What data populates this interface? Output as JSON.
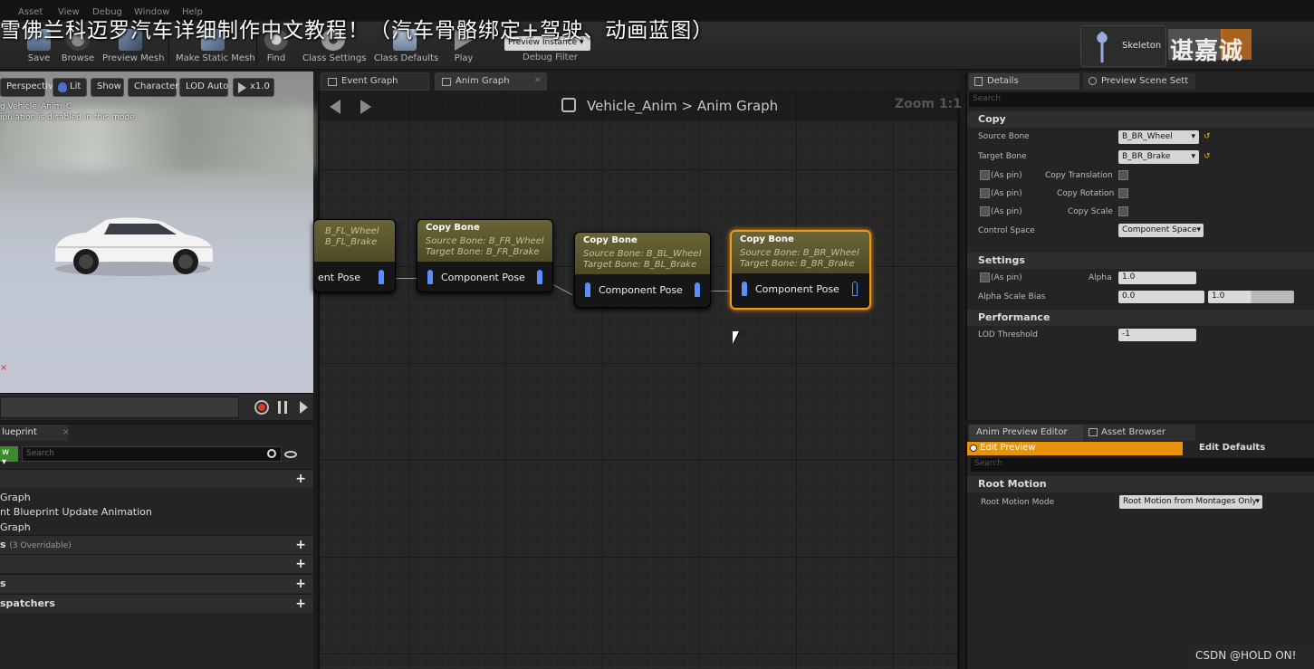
{
  "menubar": {
    "items": [
      "Asset",
      "View",
      "Debug",
      "Window",
      "Help"
    ]
  },
  "overlay_title": "雪佛兰科迈罗汽车详细制作中文教程！（汽车骨骼绑定+驾驶、动画蓝图）",
  "toolbar": {
    "buttons": [
      "Save",
      "Browse",
      "Preview Mesh",
      "Make Static Mesh",
      "Find",
      "Class Settings",
      "Class Defaults",
      "Play"
    ],
    "preview_instance": "Preview Instance",
    "debug_filter": "Debug Filter",
    "skeleton_label": "Skeleton",
    "watermark_text": "谌嘉诚"
  },
  "viewport": {
    "buttons": [
      "Perspective",
      "Lit",
      "Show",
      "Character",
      "LOD Auto",
      "x1.0"
    ],
    "info_line1": "g Vehicle_Anim_C",
    "info_line2": "ipulation is disabled in this mode."
  },
  "my_blueprint": {
    "tab": "lueprint",
    "add_label": "w",
    "search_placeholder": "Search",
    "rows": [
      {
        "label": "Graph",
        "header": false
      },
      {
        "label": "nt Blueprint Update Animation",
        "header": false
      },
      {
        "label": "Graph",
        "header": false
      },
      {
        "label": "s",
        "suffix": "(3 Overridable)",
        "header": true
      },
      {
        "label": "",
        "header": true
      },
      {
        "label": "s",
        "header": true
      },
      {
        "label": "spatchers",
        "header": true
      }
    ]
  },
  "graph": {
    "tabs": [
      "Event Graph",
      "Anim Graph"
    ],
    "breadcrumb_root": "Vehicle_Anim",
    "breadcrumb_sep": ">",
    "breadcrumb_current": "Anim Graph",
    "zoom": "Zoom 1:1",
    "nodes": [
      {
        "title": "",
        "source": "B_FL_Wheel",
        "target": "B_FL_Brake",
        "output": "ent Pose",
        "selected": false
      },
      {
        "title": "Copy Bone",
        "source": "Source Bone: B_FR_Wheel",
        "target": "Target Bone: B_FR_Brake",
        "output": "Component Pose",
        "selected": false
      },
      {
        "title": "Copy Bone",
        "source": "Source Bone: B_BL_Wheel",
        "target": "Target Bone: B_BL_Brake",
        "output": "Component Pose",
        "selected": false
      },
      {
        "title": "Copy Bone",
        "source": "Source Bone: B_BR_Wheel",
        "target": "Target Bone: B_BR_Brake",
        "output": "Component Pose",
        "selected": true
      }
    ]
  },
  "details": {
    "tabs": [
      "Details",
      "Preview Scene Sett"
    ],
    "search_placeholder": "Search",
    "copy_section": "Copy",
    "source_bone_label": "Source Bone",
    "source_bone_value": "B_BR_Wheel",
    "target_bone_label": "Target Bone",
    "target_bone_value": "B_BR_Brake",
    "as_pin": "(As pin)",
    "copy_translation": "Copy Translation",
    "copy_rotation": "Copy Rotation",
    "copy_scale": "Copy Scale",
    "control_space_label": "Control Space",
    "control_space_value": "Component Space",
    "settings_section": "Settings",
    "alpha_label": "Alpha",
    "alpha_value": "1.0",
    "alpha_scale_bias_label": "Alpha Scale Bias",
    "alpha_scale_bias_min": "0.0",
    "alpha_scale_bias_max": "1.0",
    "performance_section": "Performance",
    "lod_threshold_label": "LOD Threshold",
    "lod_threshold_value": "-1"
  },
  "anim_preview": {
    "tabs": [
      "Anim Preview Editor",
      "Asset Browser"
    ],
    "edit_preview": "Edit Preview",
    "edit_defaults": "Edit Defaults",
    "search_placeholder": "Search",
    "root_motion_section": "Root Motion",
    "root_motion_mode_label": "Root Motion Mode",
    "root_motion_mode_value": "Root Motion from Montages Only"
  },
  "csdn_watermark": "CSDN @HOLD ON!",
  "colors": {
    "selection": "#f29a1a",
    "node_header": "#5e5930",
    "pin": "#5a8fff",
    "edit_preview": "#e8930c"
  }
}
